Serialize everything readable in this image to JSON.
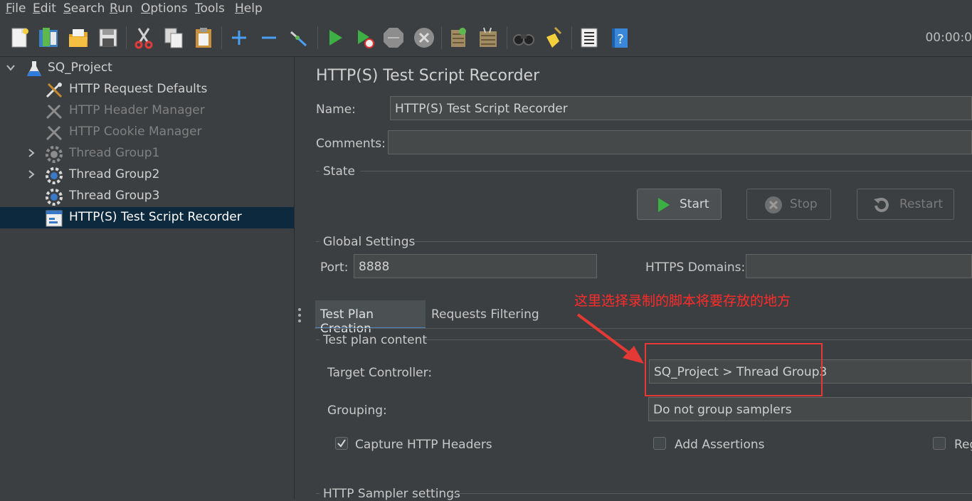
{
  "menu": [
    {
      "mnemonic": "F",
      "rest": "ile"
    },
    {
      "mnemonic": "E",
      "rest": "dit"
    },
    {
      "mnemonic": "S",
      "rest": "earch"
    },
    {
      "mnemonic": "R",
      "rest": "un"
    },
    {
      "mnemonic": "O",
      "rest": "ptions"
    },
    {
      "mnemonic": "T",
      "rest": "ools"
    },
    {
      "mnemonic": "H",
      "rest": "elp"
    }
  ],
  "toolbar": {
    "icons": [
      "new-icon",
      "templates-icon",
      "open-icon",
      "save-icon",
      "cut-icon",
      "copy-icon",
      "paste-icon",
      "expand-icon",
      "collapse-icon",
      "toggle-icon",
      "start-icon",
      "start-no-timers-icon",
      "stop-icon",
      "shutdown-icon",
      "clear-icon",
      "clear-all-icon",
      "search-icon",
      "reset-search-icon",
      "function-helper-icon",
      "help-icon"
    ],
    "timer": "00:00:0"
  },
  "tree": {
    "items": [
      {
        "label": "SQ_Project",
        "icon": "test-plan-icon",
        "expanded": true,
        "disabled": false
      },
      {
        "label": "HTTP Request Defaults",
        "icon": "config-icon",
        "disabled": false
      },
      {
        "label": "HTTP Header Manager",
        "icon": "config-icon",
        "disabled": true
      },
      {
        "label": "HTTP Cookie Manager",
        "icon": "config-icon",
        "disabled": true
      },
      {
        "label": "Thread Group1",
        "icon": "thread-group-icon",
        "disabled": true,
        "collapsed": true
      },
      {
        "label": "Thread Group2",
        "icon": "thread-group-icon",
        "disabled": false,
        "collapsed": true
      },
      {
        "label": "Thread Group3",
        "icon": "thread-group-icon",
        "disabled": false
      },
      {
        "label": "HTTP(S) Test Script Recorder",
        "icon": "recorder-icon",
        "disabled": false,
        "selected": true
      }
    ]
  },
  "main": {
    "title": "HTTP(S) Test Script Recorder",
    "name_label": "Name:",
    "name_value": "HTTP(S) Test Script Recorder",
    "comments_label": "Comments:",
    "comments_value": "",
    "state_label": "State",
    "buttons": {
      "start": "Start",
      "stop": "Stop",
      "restart": "Restart"
    },
    "global_settings_label": "Global Settings",
    "port_label": "Port:",
    "port_value": "8888",
    "https_domains_label": "HTTPS Domains:",
    "https_domains_value": "",
    "tabs": [
      "Test Plan Creation",
      "Requests Filtering"
    ],
    "test_plan_content_label": "Test plan content",
    "target_controller_label": "Target Controller:",
    "target_controller_value": "SQ_Project > Thread Group3",
    "grouping_label": "Grouping:",
    "grouping_value": "Do not group samplers",
    "checkboxes": [
      {
        "label": "Capture HTTP Headers",
        "checked": true
      },
      {
        "label": "Add Assertions",
        "checked": false
      },
      {
        "label": "Reg",
        "checked": false
      }
    ],
    "http_sampler_settings_label": "HTTP Sampler settings"
  },
  "annotation": {
    "text": "这里选择录制的脚本将要存放的地方",
    "color": "#ff2b2b"
  },
  "colors": {
    "background": "#3c3f41",
    "selection": "#0d293e",
    "annotation_red": "#e53935"
  }
}
